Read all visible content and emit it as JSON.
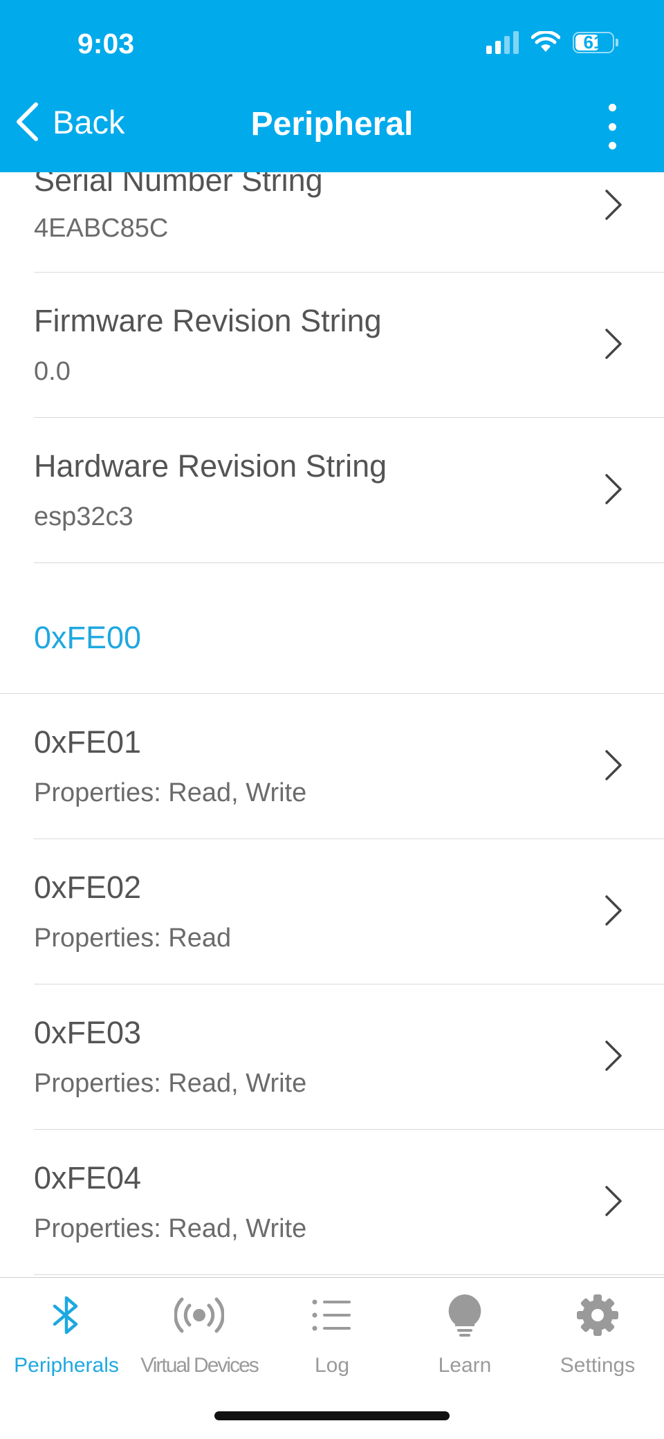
{
  "status_bar": {
    "time": "9:03",
    "battery": "61"
  },
  "nav": {
    "back_label": "Back",
    "title": "Peripheral"
  },
  "rows_top": [
    {
      "title": "Serial Number String",
      "value": "4EABC85C"
    },
    {
      "title": "Firmware Revision String",
      "value": "0.0"
    },
    {
      "title": "Hardware Revision String",
      "value": "esp32c3"
    }
  ],
  "service": {
    "uuid": "0xFE00"
  },
  "characteristics": [
    {
      "uuid": "0xFE01",
      "properties": "Properties: Read, Write"
    },
    {
      "uuid": "0xFE02",
      "properties": "Properties: Read"
    },
    {
      "uuid": "0xFE03",
      "properties": "Properties: Read, Write"
    },
    {
      "uuid": "0xFE04",
      "properties": "Properties: Read, Write"
    }
  ],
  "tabs": [
    {
      "label": "Peripherals",
      "icon": "bluetooth-icon",
      "active": true
    },
    {
      "label": "Virtual Devices",
      "icon": "broadcast-icon"
    },
    {
      "label": "Log",
      "icon": "list-icon"
    },
    {
      "label": "Learn",
      "icon": "lightbulb-icon"
    },
    {
      "label": "Settings",
      "icon": "gear-icon"
    }
  ],
  "colors": {
    "header": "#00aaeb",
    "accent": "#1ea8e0",
    "inactive_tab": "#9a9a9a"
  }
}
